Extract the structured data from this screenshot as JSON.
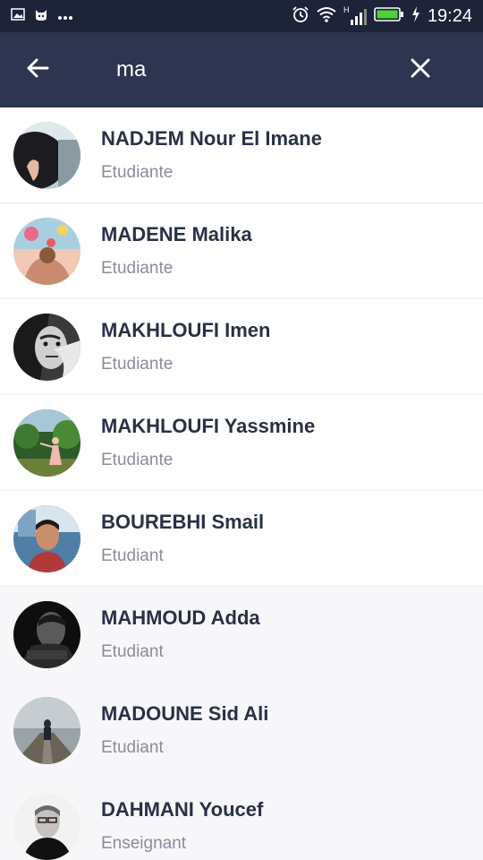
{
  "status_bar": {
    "time": "19:24",
    "signal_label": "H"
  },
  "search": {
    "value": "ma",
    "back_icon": "arrow-left-icon",
    "clear_icon": "close-icon"
  },
  "results": [
    {
      "name": "NADJEM Nour El Imane",
      "role": "Etudiante"
    },
    {
      "name": "MADENE Malika",
      "role": "Etudiante"
    },
    {
      "name": "MAKHLOUFI Imen",
      "role": "Etudiante"
    },
    {
      "name": "MAKHLOUFI Yassmine",
      "role": "Etudiante"
    },
    {
      "name": "BOUREBHI Smail",
      "role": "Etudiant"
    },
    {
      "name": "MAHMOUD Adda",
      "role": "Etudiant"
    },
    {
      "name": "MADOUNE Sid Ali",
      "role": "Etudiant"
    },
    {
      "name": "DAHMANI Youcef",
      "role": "Enseignant"
    }
  ],
  "colors": {
    "status_bar": "#1d2338",
    "search_bar": "#2d3550",
    "name_text": "#2a3046",
    "role_text": "#8a8d99",
    "battery": "#4cd137"
  }
}
